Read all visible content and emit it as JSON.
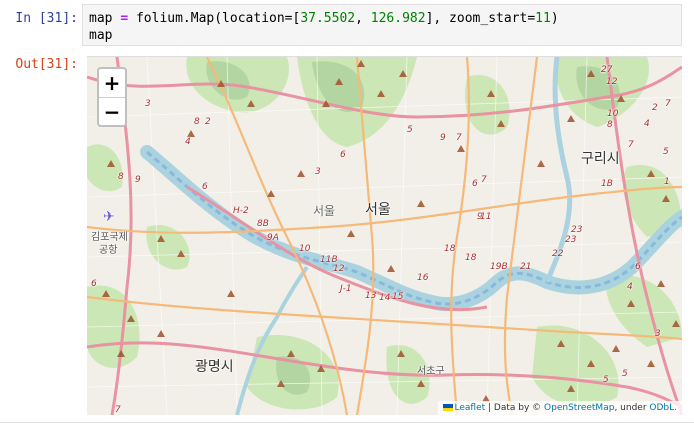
{
  "cell": {
    "in_prompt": "In [31]:",
    "out_prompt": "Out[31]:",
    "code": {
      "l1_var": "map",
      "l1_op": "=",
      "l1_a": " folium.Map(location=[",
      "l1_lat": "37.5502",
      "l1_sep": ", ",
      "l1_lon": "126.982",
      "l1_b": "], zoom_start=",
      "l1_zoom": "11",
      "l1_c": ")",
      "l2": "map"
    }
  },
  "map": {
    "zoom_in": "+",
    "zoom_out": "−",
    "labels": {
      "seoul": "서울",
      "seoul_faint": "서울",
      "guri": "구리시",
      "gwangmyeong": "광명시",
      "gimpo_airport_1": "김포국제",
      "gimpo_airport_2": "공항",
      "seocho": "서초구"
    },
    "road_numbers": [
      "2",
      "12",
      "8",
      "2",
      "10",
      "5",
      "8",
      "9",
      "4",
      "6",
      "7",
      "3",
      "6",
      "9",
      "7",
      "7",
      "8",
      "4",
      "6",
      "9",
      "5",
      "H-2",
      "8B",
      "9A",
      "10",
      "11B",
      "12",
      "11",
      "18",
      "18",
      "19B",
      "21",
      "22",
      "23",
      "23",
      "16",
      "13",
      "14",
      "15",
      "J-1",
      "4",
      "3",
      "6",
      "7",
      "2",
      "1",
      "1B",
      "4",
      "6",
      "3",
      "5",
      "5",
      "7",
      "27"
    ],
    "attribution": {
      "leaflet": "Leaflet",
      "data_by": " | Data by © ",
      "osm": "OpenStreetMap",
      "under": ", under ",
      "odbl": "ODbL."
    },
    "colors": {
      "land": "#f2efe9",
      "river": "#aad3df",
      "park": "#c8e6b0",
      "forest": "#add19e",
      "highway": "#e892a2",
      "primary": "#fcd6a4",
      "peak": "#a0522d"
    }
  }
}
